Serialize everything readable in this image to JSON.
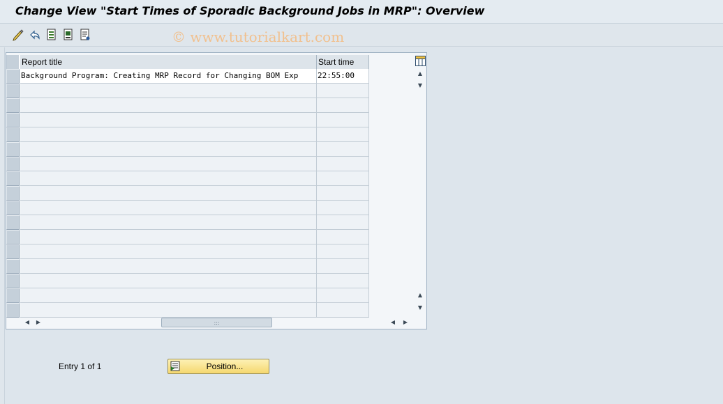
{
  "window": {
    "title": "Change View \"Start Times of Sporadic Background Jobs in MRP\": Overview"
  },
  "toolbar": {
    "icons": [
      "edit-pen-icon",
      "undo-icon",
      "document-select-icon",
      "document-save-icon",
      "document-info-icon"
    ],
    "watermark": "© www.tutorialkart.com"
  },
  "table": {
    "columns": [
      "Report title",
      "Start time"
    ],
    "rows": [
      {
        "report_title": "Background Program: Creating MRP Record for Changing BOM Exp",
        "start_time": "22:55:00"
      }
    ]
  },
  "footer": {
    "entry_text": "Entry 1 of 1",
    "position_button": "Position..."
  }
}
